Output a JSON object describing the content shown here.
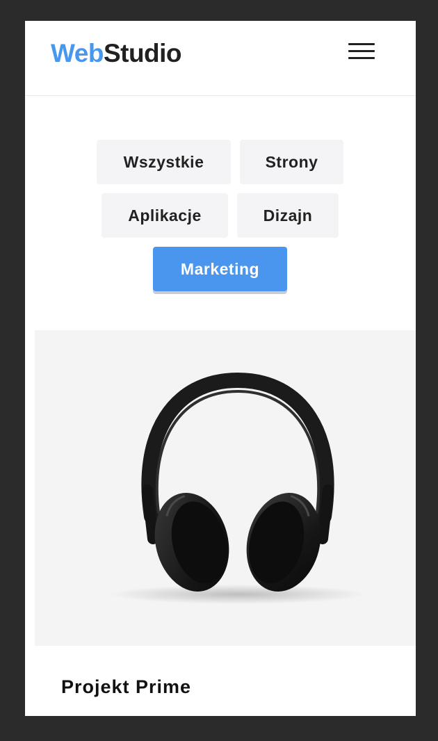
{
  "header": {
    "logo_accent": "Web",
    "logo_main": "Studio",
    "menu_icon": "hamburger-menu-icon"
  },
  "filters": [
    {
      "label": "Wszystkie",
      "active": false
    },
    {
      "label": "Strony",
      "active": false
    },
    {
      "label": "Aplikacje",
      "active": false
    },
    {
      "label": "Dizajn",
      "active": false
    },
    {
      "label": "Marketing",
      "active": true
    }
  ],
  "portfolio": {
    "items": [
      {
        "title": "Projekt Prime",
        "image": "headphones-image"
      }
    ]
  },
  "colors": {
    "accent": "#4a95ee",
    "text": "#212121",
    "filter_bg": "#f4f4f7",
    "backdrop": "#2b2b2b"
  }
}
